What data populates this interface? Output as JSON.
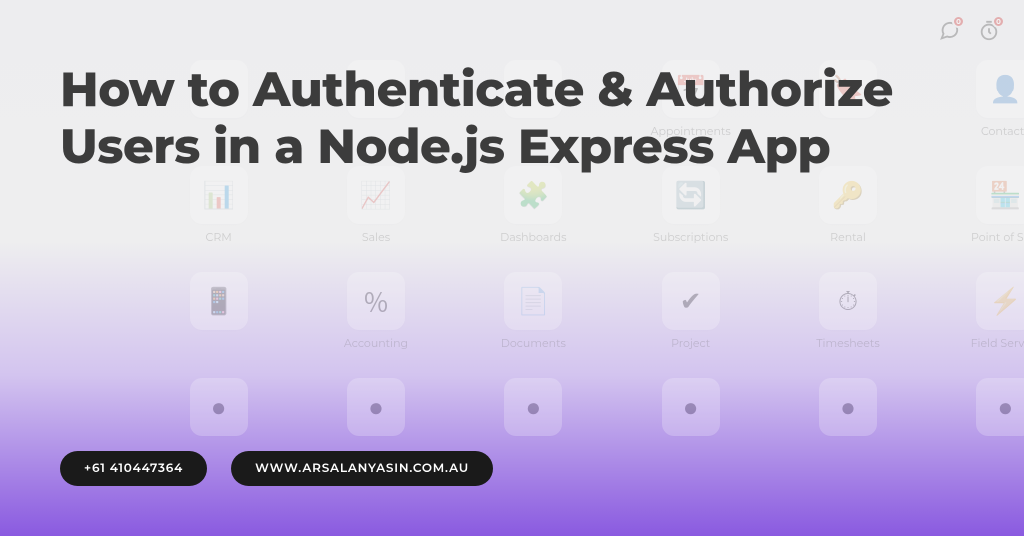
{
  "title": "How to Authenticate & Authorize Users in a Node.js Express App",
  "phone_pill": "+61 410447364",
  "site_pill": "WWW.ARSALANYASIN.COM.AU",
  "top_badges": {
    "chat": "0",
    "timer": "0"
  },
  "bg_apps": {
    "row1": [
      {
        "label": "",
        "glyph": ""
      },
      {
        "label": "",
        "glyph": ""
      },
      {
        "label": "",
        "glyph": ""
      },
      {
        "label": "Appointments",
        "glyph": "📅"
      },
      {
        "label": "",
        "glyph": "🔖"
      },
      {
        "label": "Contacts",
        "glyph": "👤"
      }
    ],
    "row2": [
      {
        "label": "CRM",
        "glyph": "📊"
      },
      {
        "label": "Sales",
        "glyph": "📈"
      },
      {
        "label": "Dashboards",
        "glyph": "🧩"
      },
      {
        "label": "Subscriptions",
        "glyph": "🔄"
      },
      {
        "label": "Rental",
        "glyph": "🔑"
      },
      {
        "label": "Point of Sale",
        "glyph": "🏪"
      }
    ],
    "row3": [
      {
        "label": "",
        "glyph": "📱"
      },
      {
        "label": "Accounting",
        "glyph": "％"
      },
      {
        "label": "Documents",
        "glyph": "📄"
      },
      {
        "label": "Project",
        "glyph": "✔"
      },
      {
        "label": "Timesheets",
        "glyph": "⏱"
      },
      {
        "label": "Field Service",
        "glyph": "⚡"
      }
    ],
    "row4": [
      {
        "label": "",
        "glyph": "●"
      },
      {
        "label": "",
        "glyph": "●"
      },
      {
        "label": "",
        "glyph": "●"
      },
      {
        "label": "",
        "glyph": "●"
      },
      {
        "label": "",
        "glyph": "●"
      },
      {
        "label": "",
        "glyph": "●"
      }
    ]
  }
}
